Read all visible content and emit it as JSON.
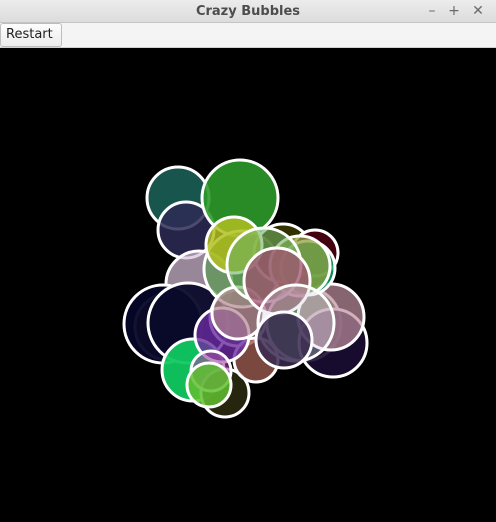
{
  "window": {
    "title": "Crazy Bubbles",
    "minimize_glyph": "–",
    "maximize_glyph": "+",
    "close_glyph": "✕"
  },
  "toolbar": {
    "restart_label": "Restart"
  },
  "canvas": {
    "background": "#000000",
    "bubble_stroke": "#ffffff"
  },
  "bubbles": [
    {
      "color": "#6b5a10",
      "opacity": 0.9
    },
    {
      "color": "#1b5e55",
      "opacity": 0.9
    },
    {
      "color": "#2d2a55",
      "opacity": 0.85
    },
    {
      "color": "#2e9a2a",
      "opacity": 0.9
    },
    {
      "color": "#d8c0d8",
      "opacity": 0.7
    },
    {
      "color": "#050528",
      "opacity": 0.95
    },
    {
      "color": "#0a0a2a",
      "opacity": 0.95
    },
    {
      "color": "#1e6e1e",
      "opacity": 0.9
    },
    {
      "color": "#1a0d33",
      "opacity": 0.9
    },
    {
      "color": "#5a4a50",
      "opacity": 0.8
    },
    {
      "color": "#c090a0",
      "opacity": 0.7
    },
    {
      "color": "#10c860",
      "opacity": 0.95
    },
    {
      "color": "#2a2a10",
      "opacity": 0.9
    },
    {
      "color": "#9a5a50",
      "opacity": 0.8
    },
    {
      "color": "#6a2aa0",
      "opacity": 0.8
    },
    {
      "color": "#5a9a50",
      "opacity": 0.7
    },
    {
      "color": "#3a3a00",
      "opacity": 0.85
    },
    {
      "color": "#4a0010",
      "opacity": 0.9
    },
    {
      "color": "#0aa060",
      "opacity": 0.85
    },
    {
      "color": "#b0c020",
      "opacity": 0.85
    },
    {
      "color": "#b08890",
      "opacity": 0.7
    },
    {
      "color": "#90a040",
      "opacity": 0.75
    },
    {
      "color": "#70b060",
      "opacity": 0.6
    },
    {
      "color": "#a05070",
      "opacity": 0.75
    },
    {
      "color": "#d0d0e0",
      "opacity": 0.35
    },
    {
      "color": "#a040a0",
      "opacity": 0.6
    },
    {
      "color": "#60c030",
      "opacity": 0.85
    },
    {
      "color": "#3a2a50",
      "opacity": 0.85
    }
  ]
}
